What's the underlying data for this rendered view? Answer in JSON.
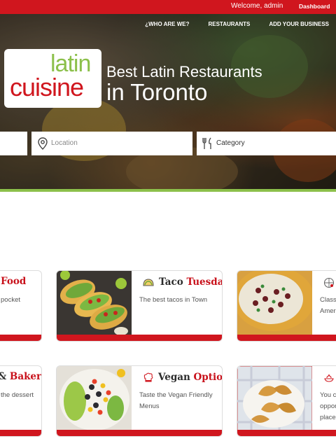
{
  "topbar": {
    "welcome": "Welcome, admin",
    "dashboard": "Dashboard"
  },
  "nav": {
    "items": [
      "¿WHO ARE WE?",
      "RESTAURANTS",
      "ADD YOUR BUSINESS"
    ]
  },
  "logo": {
    "line1": "latin",
    "line2": "cuisine"
  },
  "hero": {
    "headline_line1": "Best Latin Restaurants",
    "headline_line2": "in Toronto"
  },
  "search": {
    "location_placeholder": "Location",
    "category_placeholder": "Category"
  },
  "cards": [
    {
      "title_part1": "",
      "title_part2": "Food",
      "desc": "pocket"
    },
    {
      "title_part1": "Taco",
      "title_part2": "Tuesday",
      "desc": "The best tacos in Town",
      "icon": "taco-icon"
    },
    {
      "title_part1": "",
      "title_part2": "",
      "desc_line1": "Class",
      "desc_line2": "Ameri",
      "icon": "world-icon"
    },
    {
      "title_part1": "&",
      "title_part2": "Bakery",
      "desc": "the dessert"
    },
    {
      "title_part1": "Vegan",
      "title_part2": "Options",
      "desc_line1": "Taste the Vegan Friendly",
      "desc_line2": "Menus",
      "icon": "chef-icon"
    },
    {
      "title_part1": "",
      "title_part2": "",
      "desc_line1": "You c",
      "desc_line2": "oppor",
      "desc_line3": "places",
      "icon": "dish-icon"
    }
  ],
  "colors": {
    "brand_red": "#d0161e",
    "brand_green": "#8cc04b"
  }
}
